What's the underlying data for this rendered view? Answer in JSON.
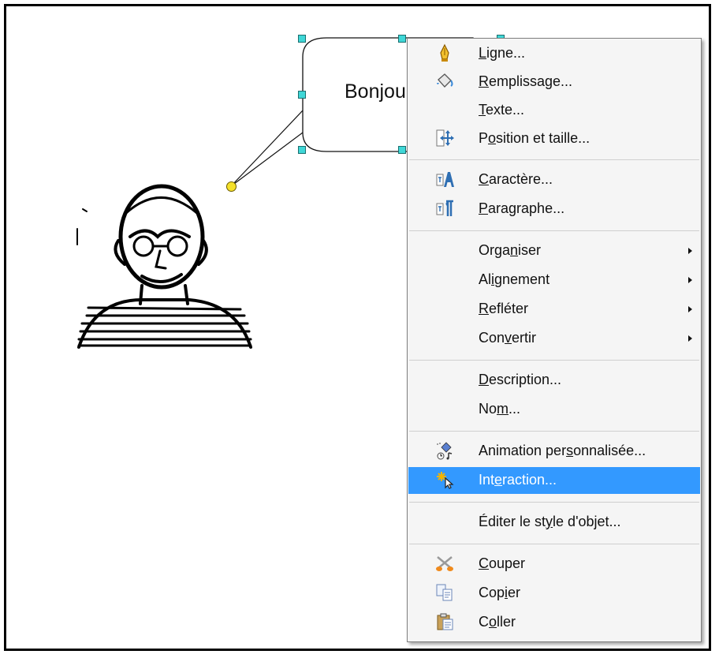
{
  "canvas": {
    "callout_text": "Bonjour"
  },
  "menu": {
    "items": [
      {
        "pre": "",
        "u": "L",
        "post": "igne...",
        "icon": "line-pen-icon"
      },
      {
        "pre": "",
        "u": "R",
        "post": "emplissage...",
        "icon": "fill-bucket-icon"
      },
      {
        "pre": "",
        "u": "T",
        "post": "exte...",
        "icon": ""
      },
      {
        "pre": "P",
        "u": "o",
        "post": "sition et taille...",
        "icon": "position-size-icon"
      },
      {
        "pre": "",
        "u": "C",
        "post": "aractère...",
        "icon": "character-icon"
      },
      {
        "pre": "",
        "u": "P",
        "post": "aragraphe...",
        "icon": "paragraph-icon"
      },
      {
        "pre": "Orga",
        "u": "n",
        "post": "iser",
        "icon": "",
        "submenu": true
      },
      {
        "pre": "Al",
        "u": "i",
        "post": "gnement",
        "icon": "",
        "submenu": true
      },
      {
        "pre": "",
        "u": "R",
        "post": "efléter",
        "icon": "",
        "submenu": true
      },
      {
        "pre": "Con",
        "u": "v",
        "post": "ertir",
        "icon": "",
        "submenu": true
      },
      {
        "pre": "",
        "u": "D",
        "post": "escription...",
        "icon": ""
      },
      {
        "pre": "No",
        "u": "m",
        "post": "...",
        "icon": ""
      },
      {
        "pre": "Animation per",
        "u": "s",
        "post": "onnalisée...",
        "icon": "animation-icon"
      },
      {
        "pre": "Int",
        "u": "e",
        "post": "raction...",
        "icon": "interaction-icon",
        "highlighted": true
      },
      {
        "pre": "Éditer le st",
        "u": "y",
        "post": "le d'objet...",
        "icon": ""
      },
      {
        "pre": "",
        "u": "C",
        "post": "ouper",
        "icon": "scissors-icon"
      },
      {
        "pre": "Cop",
        "u": "i",
        "post": "er",
        "icon": "copy-icon"
      },
      {
        "pre": "C",
        "u": "o",
        "post": "ller",
        "icon": "paste-icon"
      }
    ],
    "highlight_color": "#3399ff"
  }
}
